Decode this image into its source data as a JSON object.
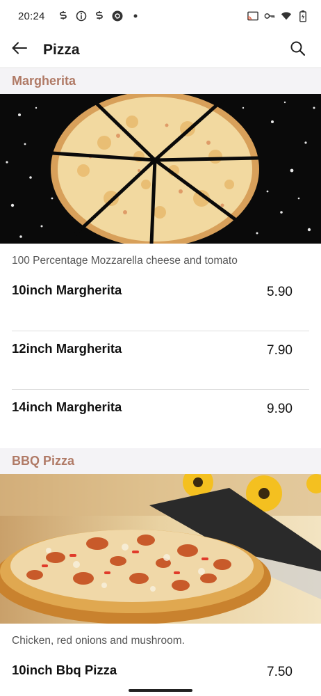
{
  "status_bar": {
    "time": "20:24",
    "icons": [
      "s-icon",
      "info-icon",
      "s-icon",
      "refresh-icon",
      "dot-icon",
      "cast-icon",
      "key-icon",
      "wifi-icon",
      "battery-icon"
    ]
  },
  "app_bar": {
    "title": "Pizza",
    "back_icon": "arrow-left-icon",
    "search_icon": "search-icon"
  },
  "sections": [
    {
      "title": "Margherita",
      "image": "margherita-pizza-image",
      "description": "100 Percentage Mozzarella cheese and tomato",
      "items": [
        {
          "name": "10inch Margherita",
          "price": "5.90"
        },
        {
          "name": "12inch Margherita",
          "price": "7.90"
        },
        {
          "name": "14inch Margherita",
          "price": "9.90"
        }
      ]
    },
    {
      "title": "BBQ Pizza",
      "image": "bbq-pizza-image",
      "description": "Chicken, red onions and mushroom.",
      "items": [
        {
          "name": "10inch Bbq Pizza",
          "price": "7.50"
        }
      ]
    }
  ],
  "colors": {
    "section_title": "#b07a66",
    "section_header_bg": "#f4f3f6",
    "divider": "#dcdcdc"
  }
}
